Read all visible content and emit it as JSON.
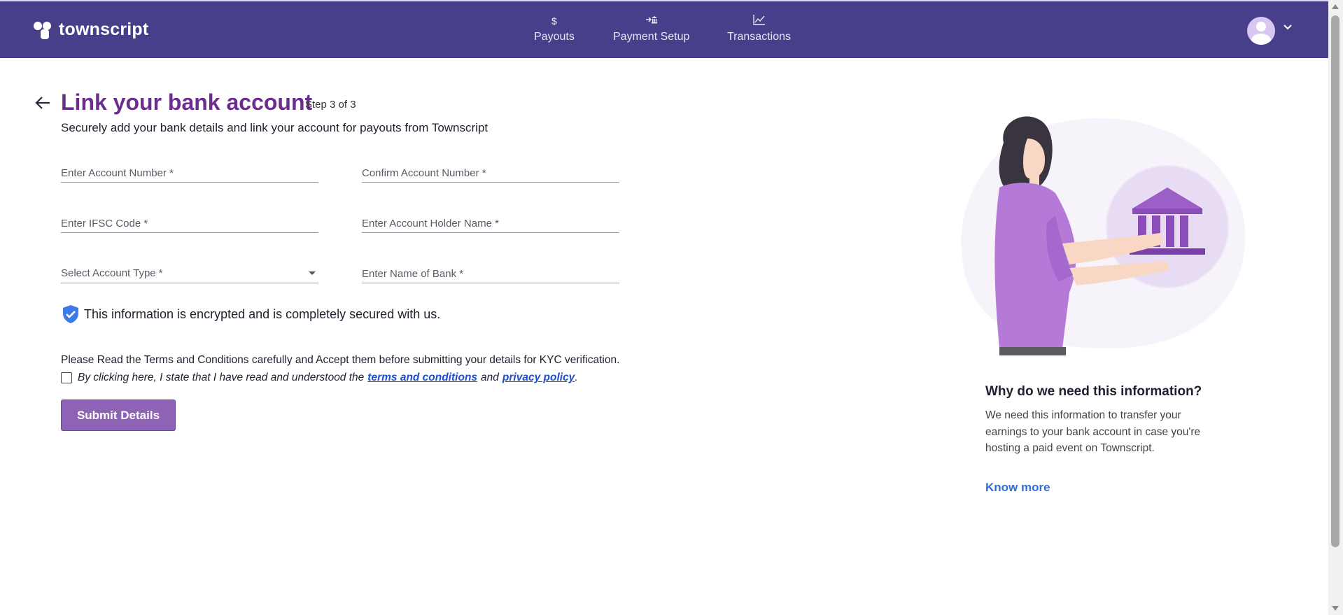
{
  "brand": {
    "name": "townscript"
  },
  "nav": [
    {
      "label": "Payouts",
      "icon": "$"
    },
    {
      "label": "Payment Setup",
      "icon": "bank-transfer-icon"
    },
    {
      "label": "Transactions",
      "icon": "chart-line-icon"
    }
  ],
  "page": {
    "title": "Link your bank account",
    "step": "Step 3 of 3",
    "subtitle": "Securely add your bank details and link your account for payouts from Townscript"
  },
  "form": {
    "account_number_placeholder": "Enter Account Number *",
    "confirm_account_number_placeholder": "Confirm Account Number *",
    "ifsc_placeholder": "Enter IFSC Code *",
    "holder_name_placeholder": "Enter Account Holder Name *",
    "account_type_placeholder": "Select Account Type *",
    "bank_name_placeholder": "Enter Name of Bank *"
  },
  "secure_note": "This information is encrypted and is completely secured with us.",
  "terms": {
    "note": "Please Read the Terms and Conditions carefully and Accept them before submitting your details for KYC verification.",
    "prefix": "By clicking here, I state that I have read and understood the",
    "terms_link": "terms and conditions",
    "and": "and",
    "privacy_link": "privacy policy",
    "suffix": "."
  },
  "submit_label": "Submit Details",
  "sidebar_info": {
    "title": "Why do we need this information?",
    "text": "We need this information to transfer your earnings to your bank account in case you're hosting a paid event on Townscript.",
    "link": "Know more"
  },
  "colors": {
    "header": "#483f8a",
    "title": "#6b2e8f",
    "button": "#8e63b5",
    "link": "#2f6fd8"
  }
}
